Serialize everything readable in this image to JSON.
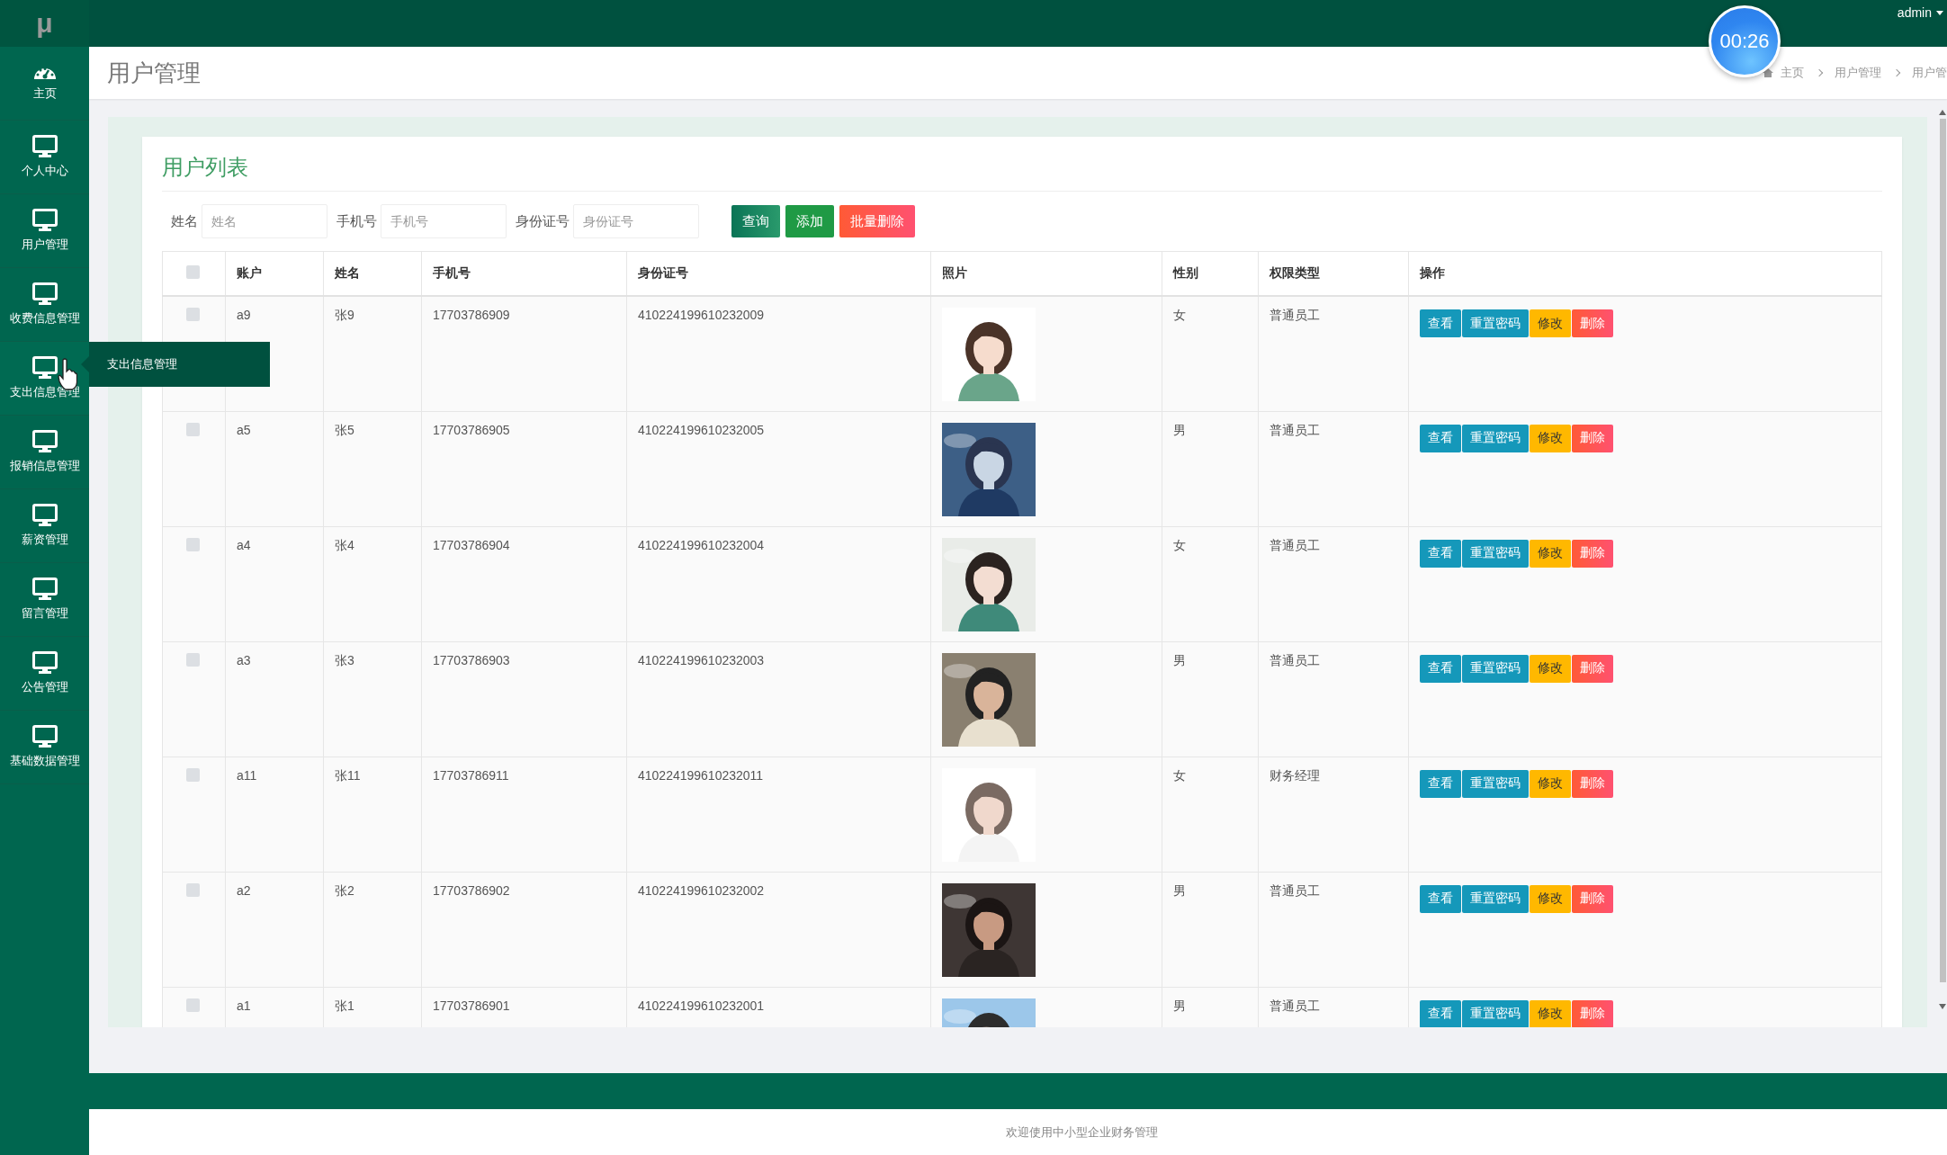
{
  "topbar": {
    "logo": "μ",
    "user": "admin"
  },
  "timer": "00:26",
  "sidebar": {
    "tooltip": "支出信息管理",
    "items": [
      {
        "label": "主页",
        "kind": "gauge",
        "hovered": false
      },
      {
        "label": "个人中心",
        "kind": "monitor",
        "hovered": false
      },
      {
        "label": "用户管理",
        "kind": "monitor",
        "hovered": false
      },
      {
        "label": "收费信息管理",
        "kind": "monitor",
        "hovered": false
      },
      {
        "label": "支出信息管理",
        "kind": "monitor",
        "hovered": true
      },
      {
        "label": "报销信息管理",
        "kind": "monitor",
        "hovered": false
      },
      {
        "label": "薪资管理",
        "kind": "monitor",
        "hovered": false
      },
      {
        "label": "留言管理",
        "kind": "monitor",
        "hovered": false
      },
      {
        "label": "公告管理",
        "kind": "monitor",
        "hovered": false
      },
      {
        "label": "基础数据管理",
        "kind": "monitor",
        "hovered": false
      }
    ]
  },
  "header": {
    "title": "用户管理",
    "breadcrumb": [
      "主页",
      "用户管理",
      "用户管"
    ]
  },
  "card": {
    "title": "用户列表",
    "filters": [
      {
        "label": "姓名",
        "placeholder": "姓名"
      },
      {
        "label": "手机号",
        "placeholder": "手机号"
      },
      {
        "label": "身份证号",
        "placeholder": "身份证号"
      }
    ],
    "buttons": [
      {
        "label": "查询",
        "kind": "primary"
      },
      {
        "label": "添加",
        "kind": "success"
      },
      {
        "label": "批量删除",
        "kind": "danger"
      }
    ],
    "table": {
      "header_checked": false,
      "columns": [
        "账户",
        "姓名",
        "手机号",
        "身份证号",
        "照片",
        "性别",
        "权限类型",
        "操作"
      ],
      "rows": [
        {
          "checked": false,
          "account": "a9",
          "name": "张9",
          "phone": "17703786909",
          "id_number": "410224199610232009",
          "gender": "女",
          "role": "普通员工",
          "actions": [
            {
              "label": "查看",
              "kind": "info"
            },
            {
              "label": "重置密码",
              "kind": "info"
            },
            {
              "label": "修改",
              "kind": "warning"
            },
            {
              "label": "删除",
              "kind": "danger"
            }
          ]
        },
        {
          "checked": false,
          "account": "a5",
          "name": "张5",
          "phone": "17703786905",
          "id_number": "410224199610232005",
          "gender": "男",
          "role": "普通员工",
          "actions": [
            {
              "label": "查看",
              "kind": "info"
            },
            {
              "label": "重置密码",
              "kind": "info"
            },
            {
              "label": "修改",
              "kind": "warning"
            },
            {
              "label": "删除",
              "kind": "danger"
            }
          ]
        },
        {
          "checked": false,
          "account": "a4",
          "name": "张4",
          "phone": "17703786904",
          "id_number": "410224199610232004",
          "gender": "女",
          "role": "普通员工",
          "actions": [
            {
              "label": "查看",
              "kind": "info"
            },
            {
              "label": "重置密码",
              "kind": "info"
            },
            {
              "label": "修改",
              "kind": "warning"
            },
            {
              "label": "删除",
              "kind": "danger"
            }
          ]
        },
        {
          "checked": false,
          "account": "a3",
          "name": "张3",
          "phone": "17703786903",
          "id_number": "410224199610232003",
          "gender": "男",
          "role": "普通员工",
          "actions": [
            {
              "label": "查看",
              "kind": "info"
            },
            {
              "label": "重置密码",
              "kind": "info"
            },
            {
              "label": "修改",
              "kind": "warning"
            },
            {
              "label": "删除",
              "kind": "danger"
            }
          ]
        },
        {
          "checked": false,
          "account": "a11",
          "name": "张11",
          "phone": "17703786911",
          "id_number": "410224199610232011",
          "gender": "女",
          "role": "财务经理",
          "actions": [
            {
              "label": "查看",
              "kind": "info"
            },
            {
              "label": "重置密码",
              "kind": "info"
            },
            {
              "label": "修改",
              "kind": "warning"
            },
            {
              "label": "删除",
              "kind": "danger"
            }
          ]
        },
        {
          "checked": false,
          "account": "a2",
          "name": "张2",
          "phone": "17703786902",
          "id_number": "410224199610232002",
          "gender": "男",
          "role": "普通员工",
          "actions": [
            {
              "label": "查看",
              "kind": "info"
            },
            {
              "label": "重置密码",
              "kind": "info"
            },
            {
              "label": "修改",
              "kind": "warning"
            },
            {
              "label": "删除",
              "kind": "danger"
            }
          ]
        },
        {
          "checked": false,
          "account": "a1",
          "name": "张1",
          "phone": "17703786901",
          "id_number": "410224199610232001",
          "gender": "男",
          "role": "普通员工",
          "actions": [
            {
              "label": "查看",
              "kind": "info"
            },
            {
              "label": "重置密码",
              "kind": "info"
            },
            {
              "label": "修改",
              "kind": "warning"
            },
            {
              "label": "删除",
              "kind": "danger"
            }
          ]
        }
      ]
    }
  },
  "footer": "欢迎使用中小型企业财务管理"
}
